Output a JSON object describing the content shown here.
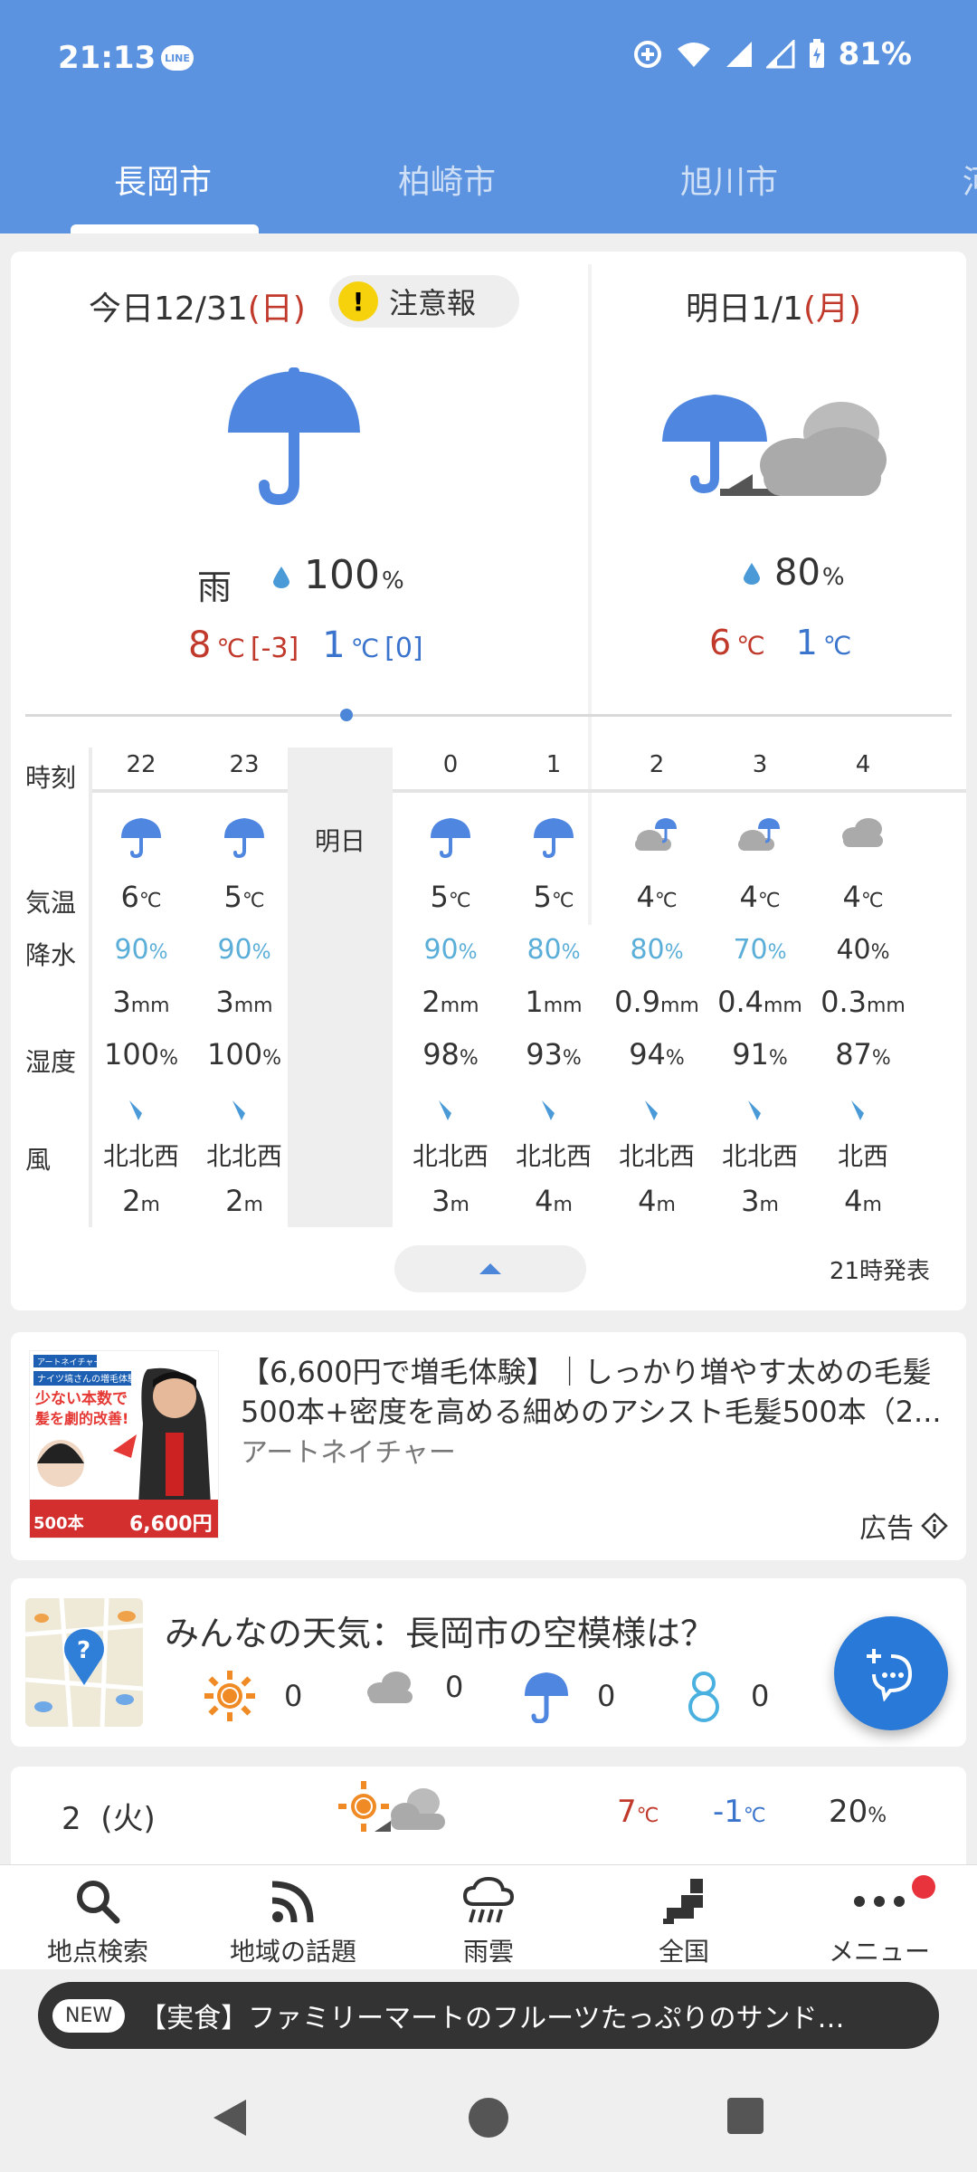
{
  "status_bar": {
    "time": "21:13",
    "notification": "LINE",
    "battery": "81%"
  },
  "tabs": [
    {
      "label": "長岡市",
      "active": true
    },
    {
      "label": "柏崎市",
      "active": false
    },
    {
      "label": "旭川市",
      "active": false
    },
    {
      "label": "河",
      "active": false
    }
  ],
  "today": {
    "prefix": "今日12/31",
    "weekday": "(日)",
    "warning": "注意報",
    "weather": "雨",
    "pop": "100",
    "pop_unit": "%",
    "high": "8",
    "high_diff": "[-3]",
    "low": "1",
    "low_diff": "[0]",
    "unit": "℃"
  },
  "tomorrow": {
    "prefix": "明日1/1",
    "weekday": "(月)",
    "pop": "80",
    "pop_unit": "%",
    "high": "6",
    "low": "1",
    "unit": "℃"
  },
  "hourly": {
    "labels": {
      "hour": "時刻",
      "temp": "気温",
      "rain": "降水",
      "humidity": "湿度",
      "wind": "風"
    },
    "tomorrow_label": "明日",
    "hours": [
      {
        "hour": "22",
        "icon": "umbrella",
        "temp": "6",
        "rain": "90",
        "amount": "3",
        "amount_unit": "mm",
        "humidity": "100",
        "wind_dir": "北北西",
        "wind_speed": "2",
        "rain_high": true
      },
      {
        "hour": "23",
        "icon": "umbrella",
        "temp": "5",
        "rain": "90",
        "amount": "3",
        "amount_unit": "mm",
        "humidity": "100",
        "wind_dir": "北北西",
        "wind_speed": "2",
        "rain_high": true
      },
      {
        "hour": "0",
        "icon": "umbrella",
        "temp": "5",
        "rain": "90",
        "amount": "2",
        "amount_unit": "mm",
        "humidity": "98",
        "wind_dir": "北北西",
        "wind_speed": "3",
        "rain_high": true
      },
      {
        "hour": "1",
        "icon": "umbrella",
        "temp": "5",
        "rain": "80",
        "amount": "1",
        "amount_unit": "mm",
        "humidity": "93",
        "wind_dir": "北北西",
        "wind_speed": "4",
        "rain_high": true
      },
      {
        "hour": "2",
        "icon": "cloud-umbrella",
        "temp": "4",
        "rain": "80",
        "amount": "0.9",
        "amount_unit": "mm",
        "humidity": "94",
        "wind_dir": "北北西",
        "wind_speed": "4",
        "rain_high": true
      },
      {
        "hour": "3",
        "icon": "cloud-umbrella",
        "temp": "4",
        "rain": "70",
        "amount": "0.4",
        "amount_unit": "mm",
        "humidity": "91",
        "wind_dir": "北北西",
        "wind_speed": "3",
        "rain_high": true
      },
      {
        "hour": "4",
        "icon": "cloud",
        "temp": "4",
        "rain": "40",
        "amount": "0.3",
        "amount_unit": "mm",
        "humidity": "87",
        "wind_dir": "北西",
        "wind_speed": "4",
        "rain_high": false
      }
    ],
    "temp_unit": "℃",
    "pct_unit": "%",
    "wind_unit": "m",
    "issued": "21時発表"
  },
  "ad": {
    "title": "【6,600円で増毛体験】｜しっかり増やす太めの毛髪500本+密度を高める細めのアシスト毛髪500本（2...",
    "advertiser": "アートネイチャー",
    "label": "広告",
    "image_text": {
      "brand": "アートネイチャー",
      "tag": "ナイツ塙さんの増毛体験!",
      "headline1": "少ない本数で",
      "headline2": "髪を劇的改善!",
      "count": "500本",
      "price": "6,600円"
    }
  },
  "community": {
    "title": "みんなの天気：長岡市の空模様は？",
    "votes": [
      {
        "icon": "sun-icon",
        "count": "0"
      },
      {
        "icon": "cloud-icon",
        "count": "0"
      },
      {
        "icon": "umbrella-icon",
        "count": "0"
      },
      {
        "icon": "snowman-icon",
        "count": "0"
      }
    ]
  },
  "weekly": {
    "day": "2",
    "weekday": "(火)",
    "high": "7",
    "low": "-1",
    "unit": "℃",
    "pop": "20",
    "pop_unit": "%"
  },
  "bottom_nav": [
    {
      "label": "地点検索",
      "icon": "search-icon"
    },
    {
      "label": "地域の話題",
      "icon": "rss-icon"
    },
    {
      "label": "雨雲",
      "icon": "rain-cloud-icon"
    },
    {
      "label": "全国",
      "icon": "japan-map-icon"
    },
    {
      "label": "メニュー",
      "icon": "more-icon"
    }
  ],
  "news": {
    "badge": "NEW",
    "text": "【実食】ファミリーマートのフルーツたっぷりのサンド…"
  },
  "colors": {
    "header": "#5b93e0",
    "umbrella": "#4f86e0",
    "high": "#c0392b",
    "low": "#3a74cc",
    "rain_pct": "#5aaed8",
    "fab": "#2979d8"
  }
}
